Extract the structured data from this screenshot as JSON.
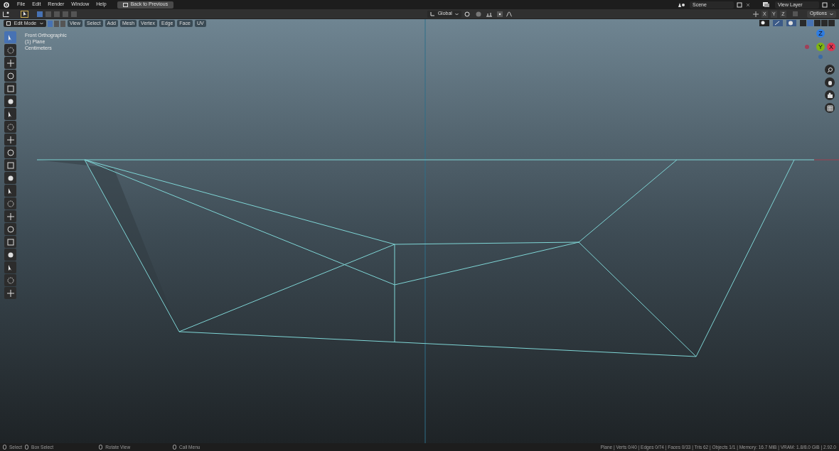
{
  "menu_bar": {
    "items": [
      "File",
      "Edit",
      "Render",
      "Window",
      "Help"
    ],
    "back_button": "Back to Previous",
    "scene": "Scene",
    "view_layer": "View Layer"
  },
  "tool_header": {
    "select_modes": [
      {
        "selected": true
      },
      {
        "selected": false
      },
      {
        "selected": false
      },
      {
        "selected": false
      },
      {
        "selected": false
      }
    ],
    "orientation": "Global",
    "axes": [
      "X",
      "Y",
      "Z"
    ],
    "options": "Options"
  },
  "viewport_header": {
    "mode": "Edit Mode",
    "element_modes": [
      {
        "selected": true
      },
      {
        "selected": false
      },
      {
        "selected": false
      }
    ],
    "menus": [
      "View",
      "Select",
      "Add",
      "Mesh",
      "Vertex",
      "Edge",
      "Face",
      "UV"
    ],
    "shading": [
      {
        "selected": false
      },
      {
        "selected": true
      },
      {
        "selected": false
      },
      {
        "selected": false
      },
      {
        "selected": false
      }
    ]
  },
  "overlay_info": [
    "Front Orthographic",
    "(1) Plane",
    "Centimeters"
  ],
  "tools": [
    {
      "selected": true
    },
    {
      "selected": false
    },
    {
      "selected": false
    },
    {
      "selected": false
    },
    {
      "selected": false
    },
    {
      "selected": false
    },
    {
      "selected": false
    },
    {
      "selected": false
    },
    {
      "selected": false
    },
    {
      "selected": false
    },
    {
      "selected": false
    },
    {
      "selected": false
    },
    {
      "selected": false
    },
    {
      "selected": false
    },
    {
      "selected": false
    },
    {
      "selected": false
    },
    {
      "selected": false
    },
    {
      "selected": false
    },
    {
      "selected": false
    },
    {
      "selected": false
    },
    {
      "selected": false
    }
  ],
  "gizmo": {
    "z": "Z",
    "y": "Y",
    "x": "X"
  },
  "status_bar": {
    "hints": [
      "Select",
      "Box Select",
      "Rotate View",
      "Call Menu"
    ],
    "stats": "Plane | Verts 0/40 | Edges 0/74 | Faces 0/33 | Tris 62 | Objects 1/1 | Memory: 16.7 MiB | VRAM: 1.8/8.0 GiB | 2.92.0"
  }
}
